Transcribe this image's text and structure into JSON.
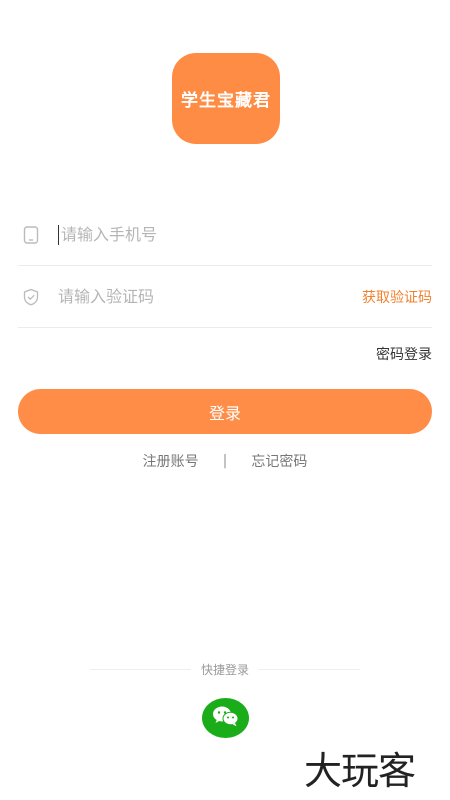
{
  "logo": {
    "text": "学生宝藏君",
    "color": "#ff8c45"
  },
  "form": {
    "phone_placeholder": "请输入手机号",
    "phone_icon": "phone-icon",
    "code_placeholder": "请输入验证码",
    "code_icon": "shield-icon",
    "get_code_label": "获取验证码"
  },
  "password_login_label": "密码登录",
  "login_button_label": "登录",
  "links": {
    "register": "注册账号",
    "separator": "|",
    "forgot": "忘记密码"
  },
  "quick_login": {
    "label": "快捷登录",
    "wechat_icon": "wechat-icon"
  },
  "watermark": "大玩客",
  "colors": {
    "accent": "#ff8d48",
    "accent_text": "#f0812f",
    "wechat": "#1aad19"
  }
}
